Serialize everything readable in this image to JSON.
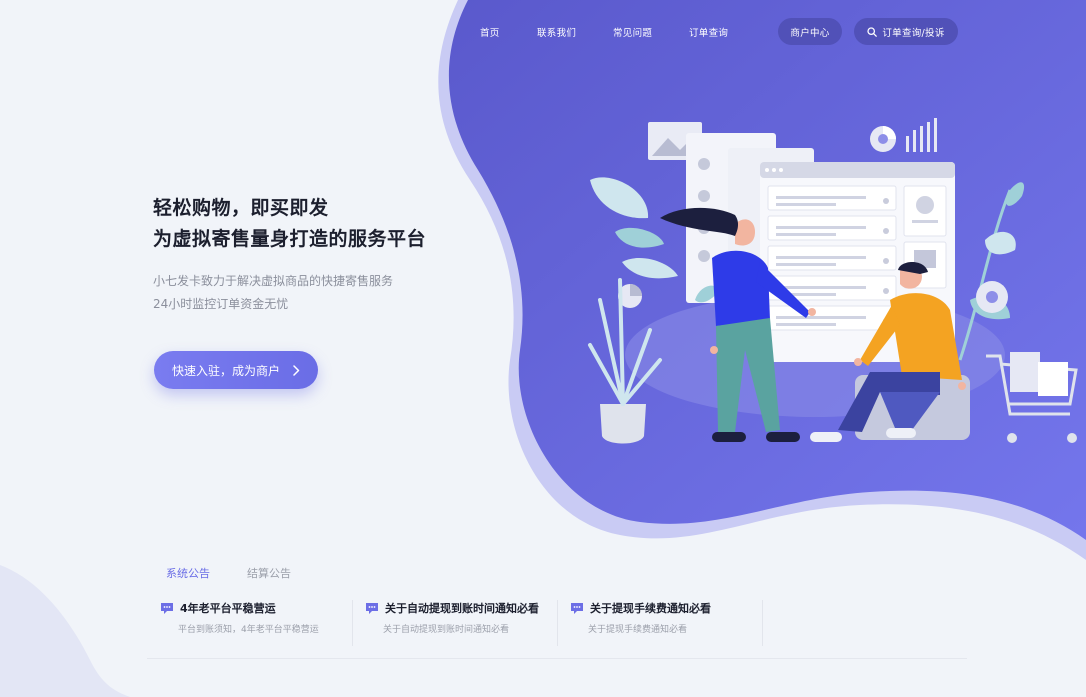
{
  "nav": {
    "links": [
      "首页",
      "联系我们",
      "常见问题",
      "订单查询"
    ],
    "merchant_button": "商户中心",
    "search_button": "订单查询/投诉"
  },
  "hero": {
    "title_line1": "轻松购物，即买即发",
    "title_line2": "为虚拟寄售量身打造的服务平台",
    "desc_line1": "小七发卡致力于解决虚拟商品的快捷寄售服务",
    "desc_line2": "24小时监控订单资金无忧",
    "cta_label": "快速入驻，成为商户"
  },
  "notices": {
    "tabs": [
      {
        "label": "系统公告",
        "active": true
      },
      {
        "label": "结算公告",
        "active": false
      }
    ],
    "items": [
      {
        "title": "4年老平台平稳营运",
        "subtitle": "平台到账须知，4年老平台平稳营运"
      },
      {
        "title": "关于自动提现到账时间通知必看",
        "subtitle": "关于自动提现到账时间通知必看"
      },
      {
        "title": "关于提现手续费通知必看",
        "subtitle": "关于提现手续费通知必看"
      }
    ]
  },
  "colors": {
    "brand": "#6c6ee6",
    "brand_dark": "#5a5bd0",
    "page_bg": "#f1f4f9",
    "tab_active": "#6a6de6",
    "tab_inactive": "#9b9faa"
  },
  "icons": {
    "search": "search-icon",
    "chevron": "chevron-right-icon",
    "notice": "message-icon"
  }
}
